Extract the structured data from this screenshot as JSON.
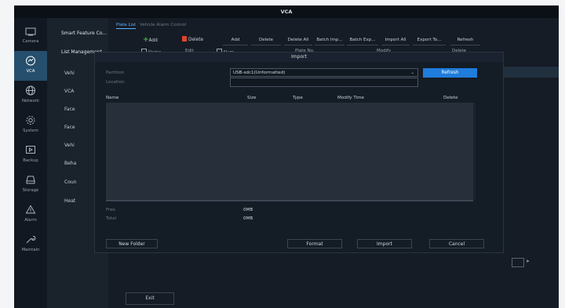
{
  "window": {
    "title": "VCA"
  },
  "sidebar": {
    "items": [
      {
        "label": "Camera",
        "icon": "camera-icon",
        "active": false
      },
      {
        "label": "VCA",
        "icon": "vca-icon",
        "active": true
      },
      {
        "label": "Network",
        "icon": "network-icon",
        "active": false
      },
      {
        "label": "System",
        "icon": "gear-icon",
        "active": false
      },
      {
        "label": "Backup",
        "icon": "backup-icon",
        "active": false
      },
      {
        "label": "Storage",
        "icon": "storage-icon",
        "active": false
      },
      {
        "label": "Alarm",
        "icon": "alarm-icon",
        "active": false
      },
      {
        "label": "Maintain",
        "icon": "wrench-icon",
        "active": false
      }
    ]
  },
  "menu": {
    "items": [
      "Smart Feature Co...",
      "List Management",
      "Vehi",
      "VCA",
      "Face",
      "Face",
      "Vehi",
      "Beha",
      "Coun",
      "Heat"
    ]
  },
  "tabs": [
    "Plate List",
    "Vehicle Alarm Control"
  ],
  "toolbar": {
    "add": "Add",
    "delete": "Delete",
    "add2": "Add",
    "delete2": "Delete",
    "delete_all": "Delete All",
    "batch_import": "Batch Imp...",
    "batch_export": "Batch Exp...",
    "import_all": "Import All",
    "export_to": "Export To...",
    "refresh": "Refresh"
  },
  "list_headers": {
    "name": "Name",
    "edit": "Edit",
    "num": "Num",
    "plate_no": "Plate No.",
    "modify": "Modify",
    "delete": "Delete"
  },
  "footer": {
    "exit": "Exit"
  },
  "dialog": {
    "title": "Import",
    "partition_label": "Partition",
    "partition_value": "USB-sdc1(Unformatted)",
    "location_label": "Location",
    "refresh": "Refresh",
    "columns": [
      "Name",
      "Size",
      "Type",
      "Modify Time",
      "Delete"
    ],
    "free_label": "Free",
    "free_value": "0MB",
    "total_label": "Total",
    "total_value": "0MB",
    "buttons": {
      "new_folder": "New Folder",
      "format": "Format",
      "import": "Import",
      "cancel": "Cancel"
    }
  },
  "colors": {
    "accent": "#1f7ddb",
    "active_nav": "#254f6c",
    "background": "#121820"
  }
}
